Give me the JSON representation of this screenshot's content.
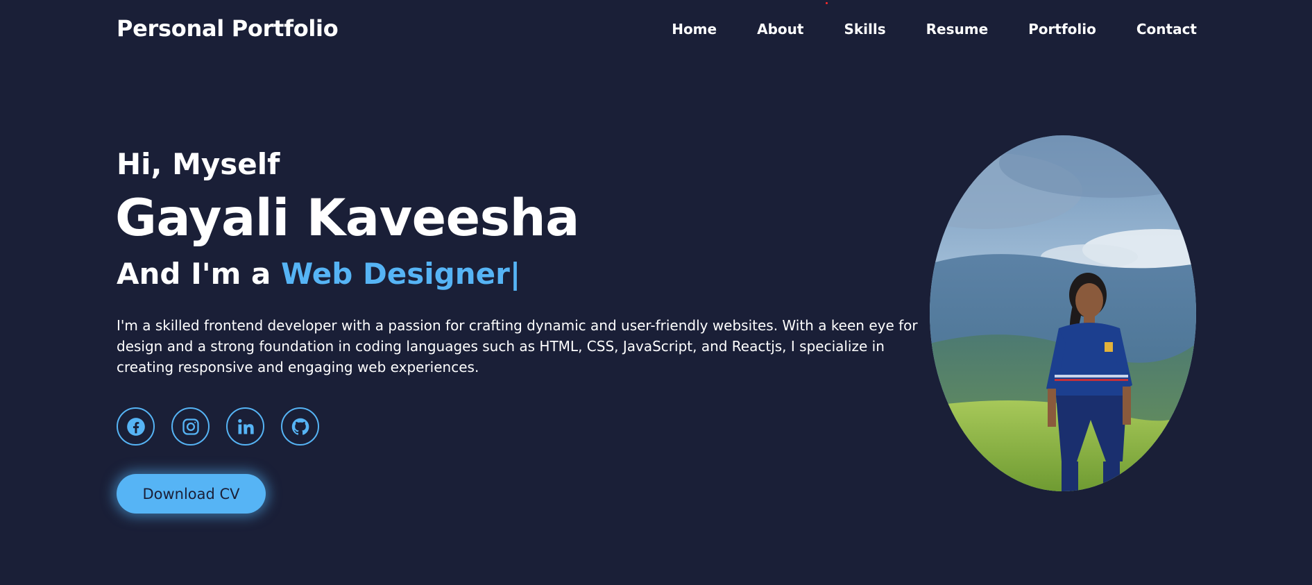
{
  "header": {
    "brand": "Personal Portfolio",
    "nav": [
      "Home",
      "About",
      "Skills",
      "Resume",
      "Portfolio",
      "Contact"
    ]
  },
  "hero": {
    "greeting": "Hi, Myself",
    "name": "Gayali Kaveesha",
    "role_prefix": "And I'm a ",
    "role": "Web Designer|",
    "description": "I'm a skilled frontend developer with a passion for crafting dynamic and user-friendly websites. With a keen eye for design and a strong foundation in coding languages such as HTML, CSS, JavaScript, and Reactjs, I specialize in creating responsive and engaging web experiences.",
    "socials": [
      {
        "icon": "facebook-icon"
      },
      {
        "icon": "instagram-icon"
      },
      {
        "icon": "linkedin-icon"
      },
      {
        "icon": "github-icon"
      }
    ],
    "download_label": "Download CV"
  },
  "colors": {
    "background": "#1a1f37",
    "accent": "#56b4f5",
    "text": "#ffffff"
  }
}
